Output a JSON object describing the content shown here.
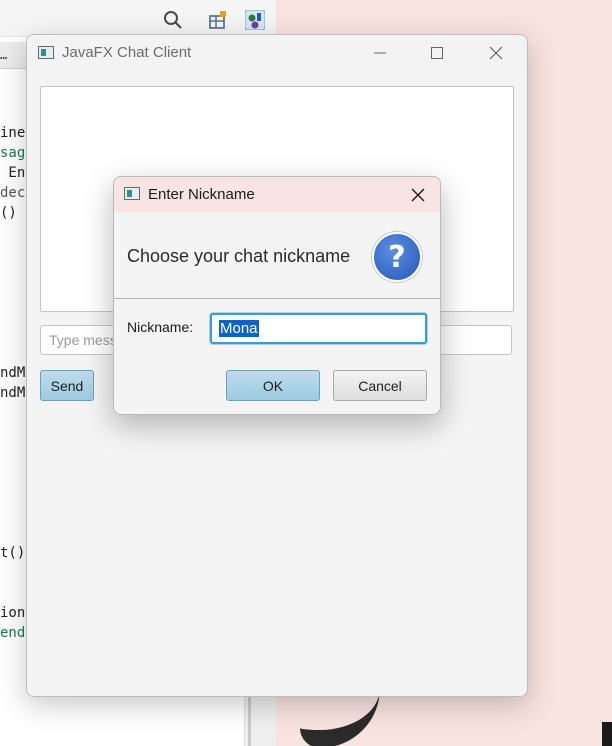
{
  "ide": {
    "tab_label": "…",
    "code_lines": [
      {
        "text": "ine",
        "style": "normal"
      },
      {
        "text": "sag",
        "style": "green"
      },
      {
        "text": " En",
        "style": "normal"
      },
      {
        "text": "dec",
        "style": "gray"
      },
      {
        "text": "()",
        "style": "normal"
      },
      {
        "text": "ndM",
        "style": "normal"
      },
      {
        "text": "ndM",
        "style": "normal"
      },
      {
        "text": "t()",
        "style": "normal"
      },
      {
        "text": "ion",
        "style": "normal"
      },
      {
        "text": "end",
        "style": "green"
      }
    ],
    "toolbar_icons": [
      "search-icon",
      "layout-icon",
      "plugin-icon"
    ]
  },
  "window": {
    "title": "JavaFX Chat Client",
    "message_placeholder": "Type message...",
    "send_label": "Send",
    "caption_icons": [
      "minimize-icon",
      "maximize-icon",
      "close-icon"
    ]
  },
  "dialog": {
    "title": "Enter Nickname",
    "header_text": "Choose your chat nickname",
    "nickname_label": "Nickname:",
    "nickname_value": "Mona",
    "ok_label": "OK",
    "cancel_label": "Cancel",
    "icon": "question-icon",
    "icon_glyph": "?"
  },
  "colors": {
    "accent_blue": "#9ecbe2",
    "focus_blue": "#3f97d6",
    "selection_blue": "#0a63c9",
    "question_icon_blue": "#2f6bd0",
    "dialog_titlebar": "#f8e4e2",
    "desktop_pink": "#f9e3e1"
  }
}
